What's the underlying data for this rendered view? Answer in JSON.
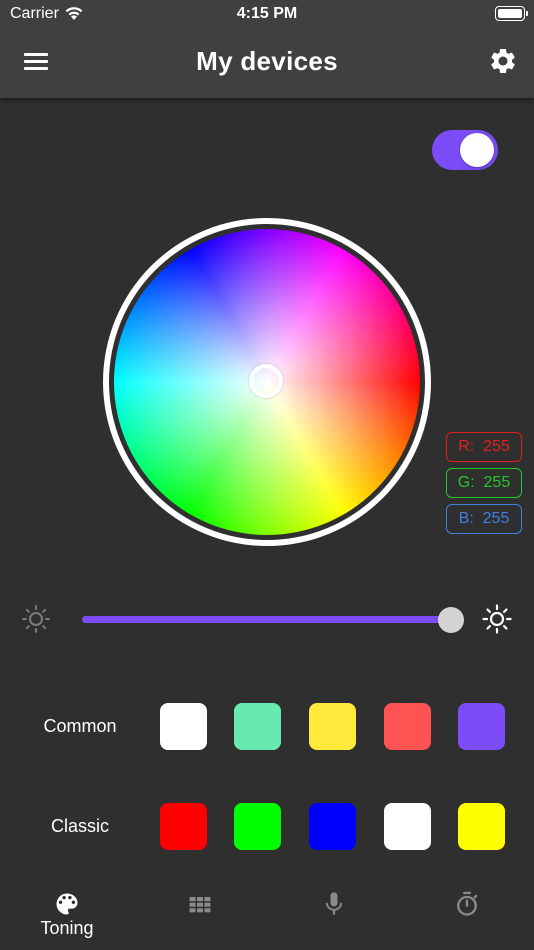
{
  "status_bar": {
    "carrier": "Carrier",
    "time": "4:15 PM"
  },
  "header": {
    "title": "My devices",
    "menu_icon": "hamburger-menu-icon",
    "settings_icon": "gear-icon"
  },
  "power_toggle": {
    "on": true
  },
  "color_picker": {
    "rgb": {
      "r_label": "R:  255",
      "g_label": "G:  255",
      "b_label": "B:  255"
    }
  },
  "brightness": {
    "level": 1.0
  },
  "presets": {
    "common": {
      "label": "Common",
      "colors": [
        "#ffffff",
        "#68e9b0",
        "#ffe93a",
        "#ff5252",
        "#7b4cf7"
      ]
    },
    "classic": {
      "label": "Classic",
      "colors": [
        "#ff0000",
        "#00ff00",
        "#0000ff",
        "#ffffff",
        "#ffff00"
      ]
    }
  },
  "tabs": [
    {
      "label": "Toning",
      "icon": "palette-icon",
      "active": true
    },
    {
      "label": "",
      "icon": "grid-icon",
      "active": false
    },
    {
      "label": "",
      "icon": "microphone-icon",
      "active": false
    },
    {
      "label": "",
      "icon": "timer-icon",
      "active": false
    }
  ],
  "colors": {
    "accent": "#7b4cf7",
    "background": "#2f2f2f",
    "header": "#404040",
    "r_border": "#e02020",
    "g_border": "#22c828",
    "b_border": "#3f7fe0"
  }
}
